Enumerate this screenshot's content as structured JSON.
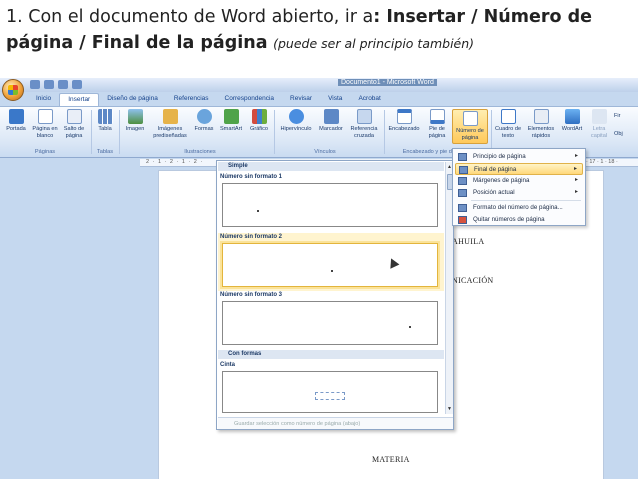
{
  "heading": {
    "part1": "1. Con el documento de Word abierto, ir a",
    "part2": ": Insertar / Número de página / Final de la página",
    "part3": "(puede ser al principio también)"
  },
  "word": {
    "doc_title": "Documento1 - Microsoft Word",
    "tabs": [
      "Inicio",
      "Insertar",
      "Diseño de página",
      "Referencias",
      "Correspondencia",
      "Revisar",
      "Vista",
      "Acrobat"
    ],
    "active_tab": "Insertar",
    "ribbon": {
      "buttons": [
        "Portada",
        "Página en blanco",
        "Salto de página",
        "Tabla",
        "Imagen",
        "Imágenes prediseñadas",
        "Formas",
        "SmartArt",
        "Gráfico",
        "Hipervínculo",
        "Marcador",
        "Referencia cruzada",
        "Encabezado",
        "Pie de página",
        "Número de página",
        "Cuadro de texto",
        "Elementos rápidos",
        "WordArt",
        "Letra capital",
        "Fir",
        "Obj"
      ],
      "groups": [
        "Páginas",
        "Tablas",
        "Ilustraciones",
        "Vínculos",
        "Encabezado y pie de página"
      ]
    },
    "ruler_left": "2 · 1 · 2 · 1 · 2 ·",
    "ruler_right": "· 17 · 1 · 18 ·",
    "page_text": {
      "line1": "AHUILA",
      "line2": "NICACIÓN",
      "line3": "MATERIA"
    },
    "gallery": {
      "section_simple": "Simple",
      "item1": "Número sin formato 1",
      "item2": "Número sin formato 2",
      "item3": "Número sin formato 3",
      "section_shapes": "Con formas",
      "item4": "Cinta",
      "footer": "Guardar selección como número de página (abajo)"
    },
    "menu": {
      "items": [
        "Principio de página",
        "Final de página",
        "Márgenes de página",
        "Posición actual",
        "Formato del número de página...",
        "Quitar números de página"
      ],
      "highlighted": "Final de página"
    }
  }
}
